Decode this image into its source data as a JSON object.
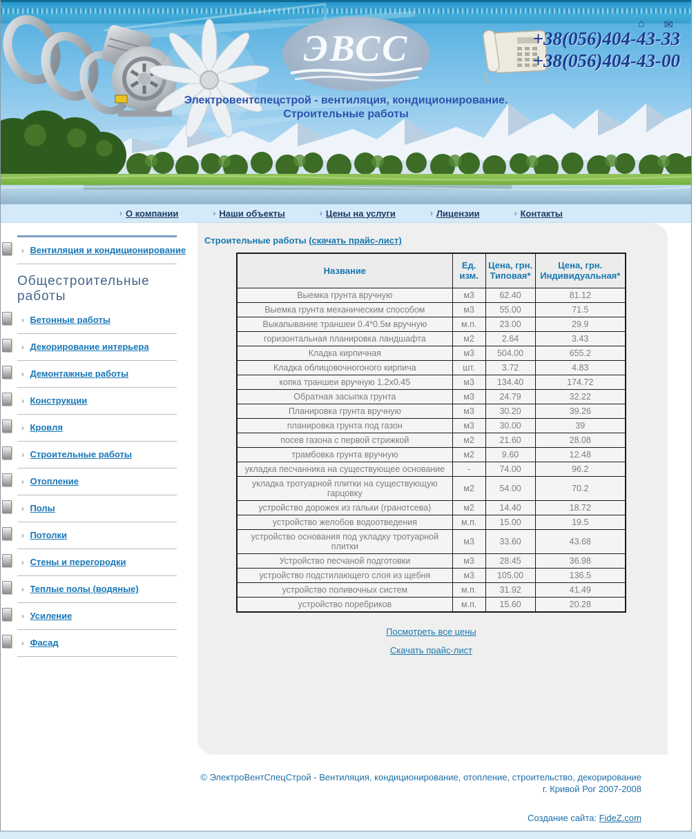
{
  "header": {
    "logo_text": "ЭВСС",
    "phone1": "+38(056)404-43-33",
    "phone2": "+38(056)404-43-00",
    "tagline_line1": "Электровентспецстрой - вентиляция, кондиционирование.",
    "tagline_line2": "Строительные работы",
    "home_icon_glyph": "⌂",
    "mail_icon_glyph": "✉"
  },
  "nav": {
    "bullet_glyph": "›",
    "items": [
      "О компании",
      "Наши объекты",
      "Цены на услуги",
      "Лицензии",
      "Контакты"
    ]
  },
  "sidebar": {
    "arrow_glyph": "›",
    "top_item": "Вентиляция и кондиционирование",
    "heading": "Общестроительные работы",
    "items": [
      "Бетонные работы",
      "Декорирование интерьера",
      "Демонтажные работы",
      "Конструкции",
      "Кровля",
      "Строительные работы",
      "Отопление",
      "Полы",
      "Потолки",
      "Стены и перегородки",
      "Теплые полы (водяные)",
      "Усиление",
      "Фасад"
    ]
  },
  "main": {
    "title": "Строительные работы",
    "title_link": "(скачать прайс-лист)",
    "table": {
      "headers": [
        "Название",
        "Ед. изм.",
        "Цена, грн. Типовая*",
        "Цена, грн. Индивидуальная*"
      ],
      "rows": [
        [
          "Выемка грунта вручную",
          "м3",
          "62.40",
          "81.12"
        ],
        [
          "Выемка грунта механическим способом",
          "м3",
          "55.00",
          "71.5"
        ],
        [
          "Выкапывание траншеи 0.4*0.5м вручную",
          "м.п.",
          "23.00",
          "29.9"
        ],
        [
          "горизонтальная планировка ландшафта",
          "м2",
          "2.64",
          "3.43"
        ],
        [
          "Кладка кирпичная",
          "м3",
          "504.00",
          "655.2"
        ],
        [
          "Кладка облицовочногоного кирпича",
          "шт.",
          "3.72",
          "4.83"
        ],
        [
          "копка траншеи вручную 1.2x0.45",
          "м3",
          "134.40",
          "174.72"
        ],
        [
          "Обратная засыпка грунта",
          "м3",
          "24.79",
          "32.22"
        ],
        [
          "Планировка грунта вручную",
          "м3",
          "30.20",
          "39.26"
        ],
        [
          "планировка грунта под газон",
          "м3",
          "30.00",
          "39"
        ],
        [
          "посев газона с первой стрижкой",
          "м2",
          "21.60",
          "28.08"
        ],
        [
          "трамбовка грунта вручную",
          "м2",
          "9.60",
          "12.48"
        ],
        [
          "укладка песчанника на существующее основание",
          "-",
          "74.00",
          "96.2"
        ],
        [
          "укладка тротуарной плитки на существующую гарцовку",
          "м2",
          "54.00",
          "70.2"
        ],
        [
          "устройство дорожек из гальки (гранотсева)",
          "м2",
          "14.40",
          "18.72"
        ],
        [
          "устройство желобов водоотведения",
          "м.п.",
          "15.00",
          "19.5"
        ],
        [
          "устройство основания под укладку тротуарной плитки",
          "м3",
          "33.60",
          "43.68"
        ],
        [
          "Устройство песчаной подготовки",
          "м3",
          "28.45",
          "36.98"
        ],
        [
          "устройство подстилающего слоя из щебня",
          "м3",
          "105.00",
          "136.5"
        ],
        [
          "устройство поливочных систем",
          "м.п.",
          "31.92",
          "41.49"
        ],
        [
          "устройство поребриков",
          "м.п.",
          "15.60",
          "20.28"
        ]
      ]
    },
    "link_all_prices": "Посмотреть все цены",
    "link_download": "Скачать прайс-лист"
  },
  "footer": {
    "line1": "© ЭлектроВентСпецСтрой - Вентиляция, кондиционирование, отопление, строительство, декорирование",
    "line2": "г. Кривой Рог 2007-2008",
    "credit_label": "Создание сайта:",
    "credit_link": "FideZ.com"
  },
  "colors": {
    "link_blue": "#1878b0",
    "nav_navy": "#1e3c64",
    "tagline_blue": "#2b53ae",
    "panel_gray": "#efefef",
    "navbar_blue": "#d4eaf8"
  }
}
